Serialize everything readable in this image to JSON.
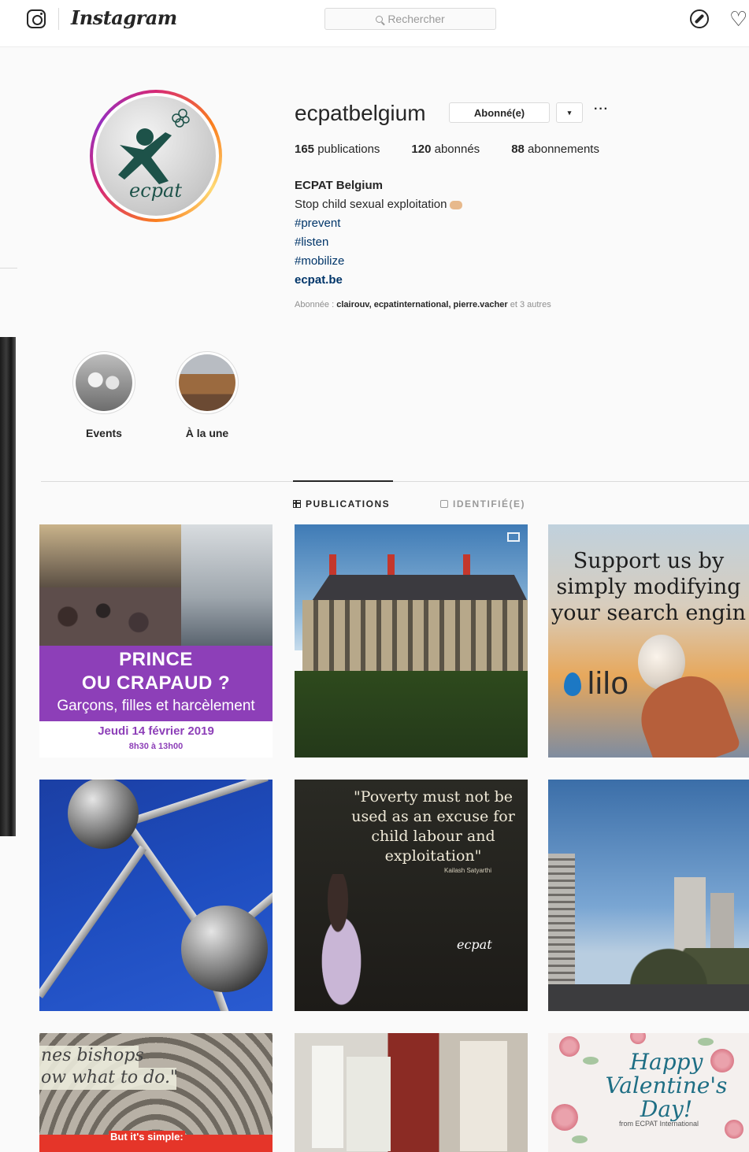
{
  "nav": {
    "wordmark": "Instagram",
    "search_placeholder": "Rechercher",
    "icons": [
      "instagram-glyph-icon",
      "search-icon",
      "explore-compass-icon",
      "heart-icon"
    ]
  },
  "profile": {
    "username": "ecpatbelgium",
    "follow_button": "Abonné(e)",
    "dropdown_button": "▾",
    "more": "···",
    "stats": {
      "posts_count": "165",
      "posts_label": "publications",
      "followers_count": "120",
      "followers_label": "abonnés",
      "following_count": "88",
      "following_label": "abonnements"
    },
    "bio": {
      "name": "ECPAT Belgium",
      "line": "Stop child sexual exploitation",
      "tags": [
        "#prevent",
        "#listen",
        "#mobilize"
      ],
      "link": "ecpat.be"
    },
    "followed_by": {
      "prefix": "Abonnée : ",
      "names": "clairouv, ecpatinternational, pierre.vacher",
      "suffix": " et 3 autres"
    }
  },
  "highlights": [
    {
      "label": "Events"
    },
    {
      "label": "À la une"
    }
  ],
  "tabs": {
    "publications": "PUBLICATIONS",
    "tagged": "IDENTIFIÉ(E)"
  },
  "posts": {
    "p1": {
      "line1": "PRINCE",
      "line2": "OU CRAPAUD ?",
      "line3": "Garçons, filles et harcèlement",
      "date": "Jeudi 14 février 2019",
      "time": "8h30 à 13h00"
    },
    "p3": {
      "line1": "Support us by",
      "line2": "simply modifying",
      "line3": "your search engin",
      "brand": "lilo"
    },
    "p5": {
      "quote": "\"Poverty must not be used as an excuse for child labour and exploitation\"",
      "author": "Kailash Satyarthi",
      "logo": "ecpat"
    },
    "p7": {
      "line1": "nes bishops",
      "line2": "ow what to do.\"",
      "line3": "But it's simple:"
    },
    "p9": {
      "line1": "Happy",
      "line2": "Valentine's",
      "line3": "Day!",
      "from": "from ECPAT International"
    }
  },
  "colors": {
    "link_blue": "#003569",
    "event_purple": "#8d3fb8",
    "valentine_teal": "#1e6e84"
  }
}
